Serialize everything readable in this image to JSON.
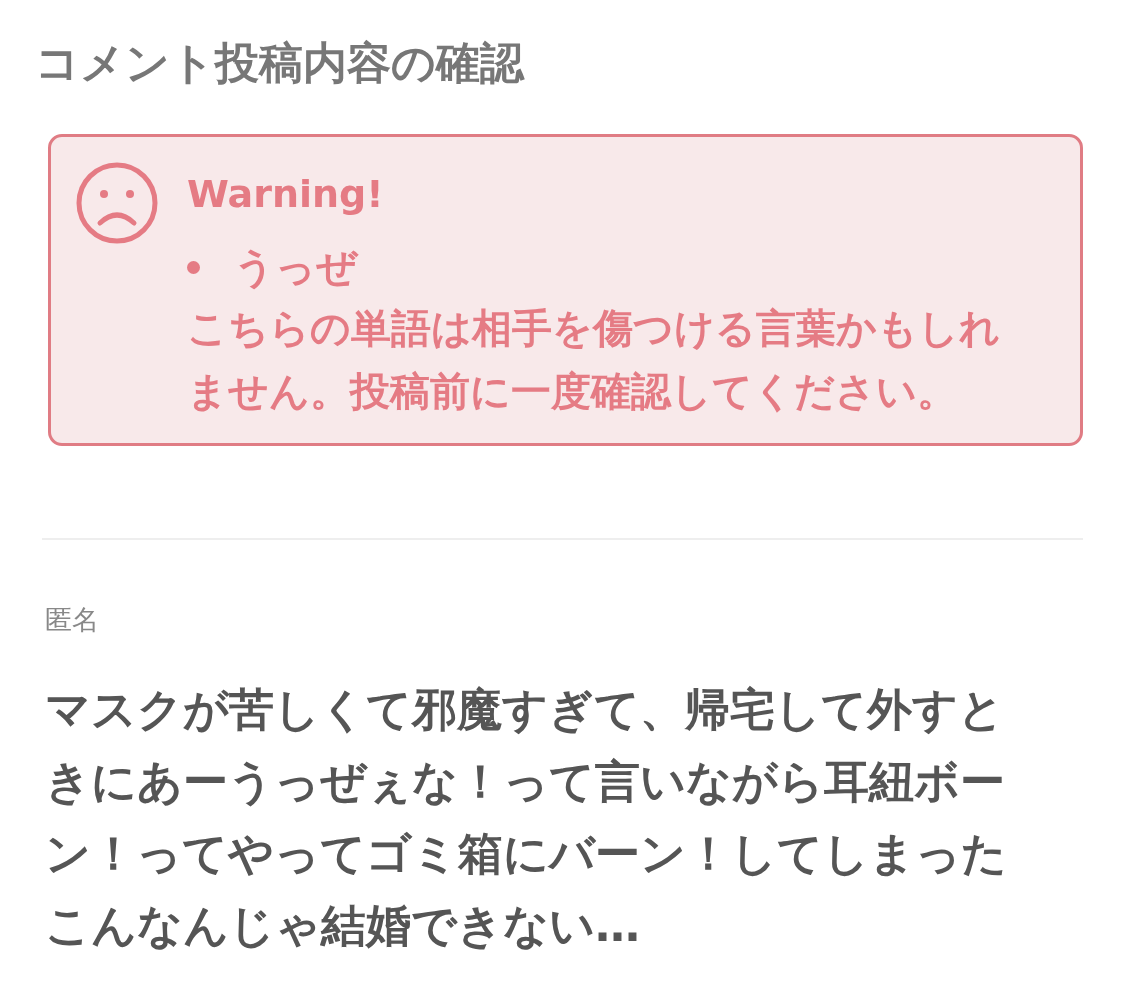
{
  "title": "コメント投稿内容の確認",
  "warning": {
    "heading": "Warning!",
    "words": [
      "うっぜ"
    ],
    "message": "こちらの単語は相手を傷つける言葉かもしれません。投稿前に一度確認してください。"
  },
  "author": "匿名",
  "comment": "マスクが苦しくて邪魔すぎて、帰宅して外すときにあーうっぜぇな！って言いながら耳紐ボーン！ってやってゴミ箱にバーン！してしまったこんなんじゃ結婚できない…"
}
